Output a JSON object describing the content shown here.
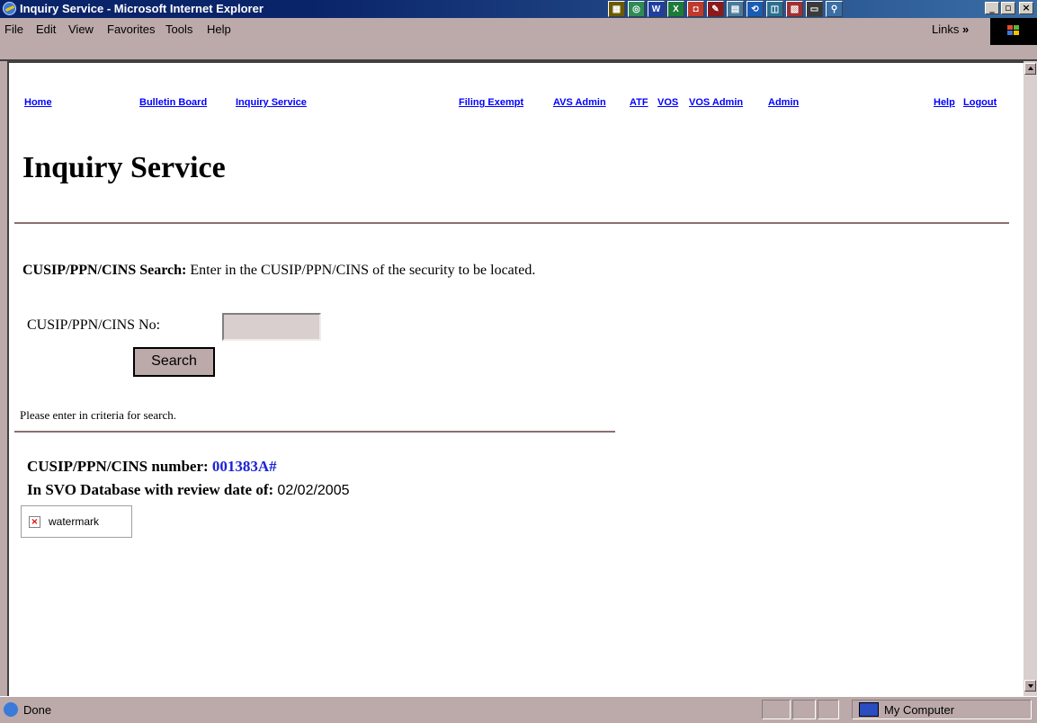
{
  "window": {
    "title": "Inquiry Service - Microsoft Internet Explorer",
    "minimize": "_",
    "maximize": "▫",
    "close": "×"
  },
  "menu": {
    "items": [
      "File",
      "Edit",
      "View",
      "Favorites",
      "Tools",
      "Help"
    ],
    "links_label": "Links",
    "links_chevron": "»"
  },
  "nav": {
    "home": "Home",
    "bulletin_board": "Bulletin Board",
    "inquiry_service": "Inquiry Service",
    "filing_exempt": "Filing Exempt",
    "avs_admin": "AVS Admin",
    "atf": "ATF",
    "vos": "VOS",
    "vos_admin": "VOS Admin",
    "admin": "Admin",
    "help": "Help",
    "logout": "Logout"
  },
  "page": {
    "title": "Inquiry Service",
    "search_heading": "CUSIP/PPN/CINS Search:",
    "search_description": "Enter in the CUSIP/PPN/CINS of the security to be located.",
    "field_label": "CUSIP/PPN/CINS No:",
    "field_value": "",
    "search_button": "Search",
    "hint": "Please enter in criteria for search.",
    "result_label": "CUSIP/PPN/CINS number:",
    "result_value": "001383A#",
    "svo_label": "In SVO Database with review date of:",
    "svo_date": "02/02/2005",
    "image_alt": "watermark"
  },
  "status": {
    "text": "Done",
    "zone": "My Computer"
  },
  "colors": {
    "chrome": "#bca9a9",
    "title_bar": "#0a246a",
    "link": "#0000ff",
    "result_value": "#1a23d6",
    "rule": "#8a7070"
  },
  "icons": [
    "ie-logo-icon",
    "windows-logo-icon",
    "broken-image-icon",
    "computer-icon"
  ]
}
